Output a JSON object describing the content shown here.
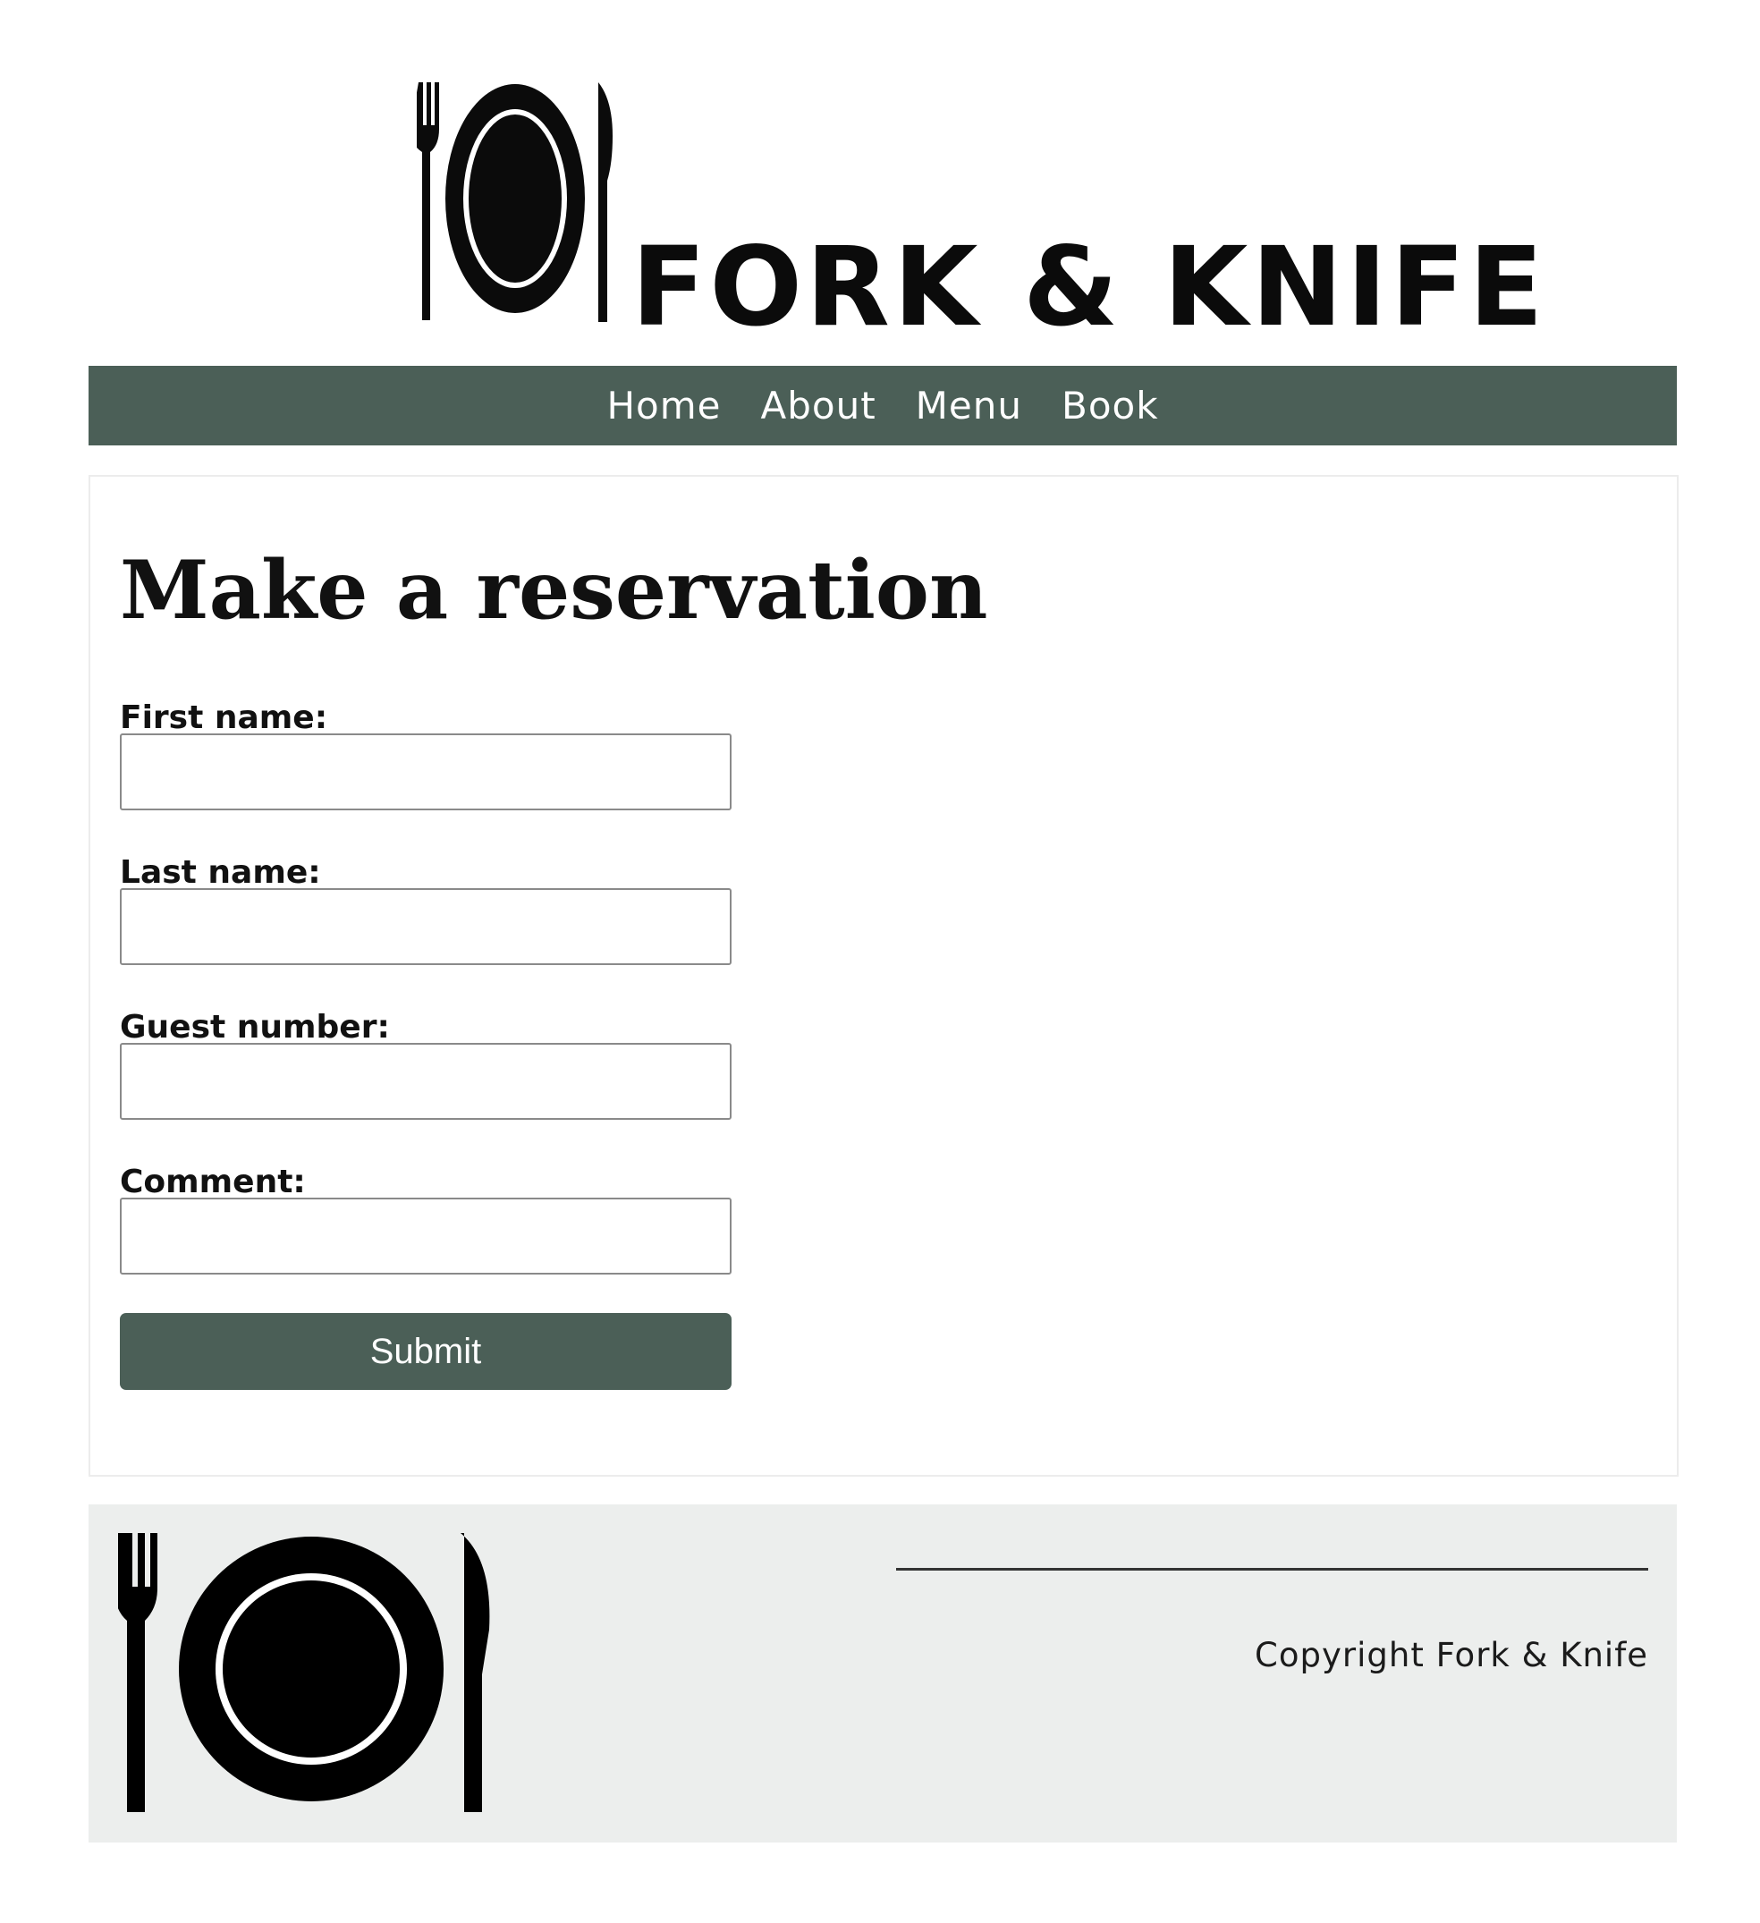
{
  "header": {
    "logo_text": "FORK & KNIFE",
    "logo_icon": "fork-plate-knife-icon"
  },
  "nav": {
    "items": [
      {
        "label": "Home"
      },
      {
        "label": "About"
      },
      {
        "label": "Menu"
      },
      {
        "label": "Book"
      }
    ]
  },
  "main": {
    "title": "Make a reservation",
    "form": {
      "first_name_label": "First name:",
      "first_name_value": "",
      "last_name_label": "Last name:",
      "last_name_value": "",
      "guest_number_label": "Guest number:",
      "guest_number_value": "",
      "comment_label": "Comment:",
      "comment_value": "",
      "submit_label": "Submit"
    }
  },
  "footer": {
    "logo_icon": "fork-plate-knife-icon",
    "copyright": "Copyright Fork & Knife"
  },
  "colors": {
    "accent": "#4b5f57",
    "footer_bg": "#eceeed",
    "text": "#111111"
  }
}
